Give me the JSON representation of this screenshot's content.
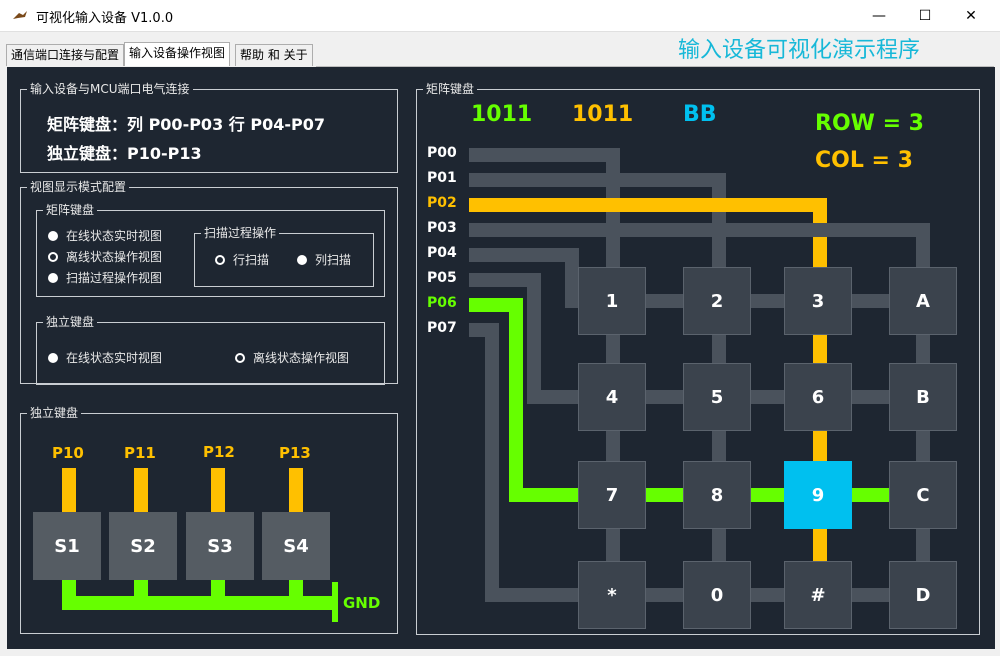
{
  "window": {
    "title": "可视化输入设备 V1.0.0",
    "min": "—",
    "max": "☐",
    "close": "✕"
  },
  "tabs": [
    "通信端口连接与配置",
    "输入设备操作视图",
    "帮助 和 关于"
  ],
  "app_heading": "输入设备可视化演示程序",
  "conn": {
    "title": "输入设备与MCU端口电气连接",
    "line1": "矩阵键盘：列 P00-P03 行 P04-P07",
    "line2": "独立键盘：P10-P13"
  },
  "view_cfg": {
    "title": "视图显示模式配置",
    "matrix": {
      "title": "矩阵键盘",
      "opt_online": "在线状态实时视图",
      "opt_offline": "离线状态操作视图",
      "opt_scan": "扫描过程操作视图"
    },
    "scan": {
      "title": "扫描过程操作",
      "row": "行扫描",
      "col": "列扫描"
    },
    "indep": {
      "title": "独立键盘",
      "opt_online": "在线状态实时视图",
      "opt_offline": "离线状态操作视图"
    }
  },
  "indep_kbd": {
    "title": "独立键盘",
    "ports": [
      "P10",
      "P11",
      "P12",
      "P13"
    ],
    "keys": [
      "S1",
      "S2",
      "S3",
      "S4"
    ],
    "gnd": "GND"
  },
  "matrix_kbd": {
    "title": "矩阵键盘",
    "code1": "1011",
    "code2": "1011",
    "hex": "BB",
    "row_text": "ROW = 3",
    "col_text": "COL = 3",
    "ports": [
      "P00",
      "P01",
      "P02",
      "P03",
      "P04",
      "P05",
      "P06",
      "P07"
    ],
    "keys": [
      "1",
      "2",
      "3",
      "A",
      "4",
      "5",
      "6",
      "B",
      "7",
      "8",
      "9",
      "C",
      "*",
      "0",
      "#",
      "D"
    ],
    "pressed_key": "9",
    "colors": {
      "active_col": "#ffc000",
      "active_row": "#66ff00",
      "pressed": "#00c0ef",
      "wire": "#4a525c"
    }
  }
}
